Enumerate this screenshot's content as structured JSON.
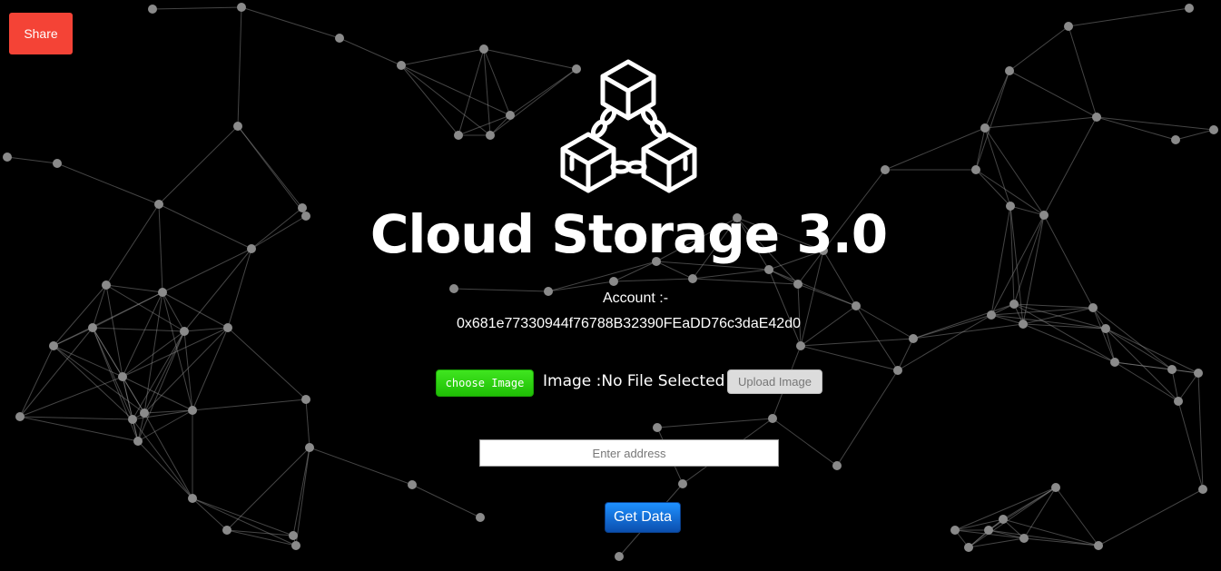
{
  "header": {
    "share_label": "Share"
  },
  "hero": {
    "title": "Cloud Storage 3.0"
  },
  "account": {
    "label": "Account :-",
    "address": "0x681e77330944f76788B32390FEaDD76c3daE42d0"
  },
  "upload": {
    "choose_label": "choose Image",
    "status_text": "Image :No File Selected",
    "upload_label": "Upload Image"
  },
  "query": {
    "address_placeholder": "Enter address",
    "address_value": "",
    "get_data_label": "Get Data"
  },
  "colors": {
    "background": "#000000",
    "share": "#f44336",
    "choose": "#28d010",
    "get_data": "#1565c0",
    "network": "#8a8a8a"
  },
  "icons": {
    "logo": "blockchain-cubes-icon"
  }
}
